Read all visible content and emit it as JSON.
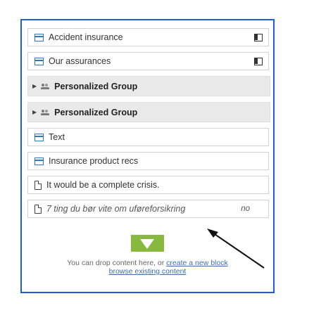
{
  "items": [
    {
      "kind": "block",
      "label": "Accident insurance",
      "action": "folder-icon"
    },
    {
      "kind": "block",
      "label": "Our assurances",
      "action": "folder-icon"
    },
    {
      "kind": "group",
      "label": "Personalized Group"
    },
    {
      "kind": "group",
      "label": "Personalized Group"
    },
    {
      "kind": "block",
      "label": "Text"
    },
    {
      "kind": "block",
      "label": "Insurance product recs"
    },
    {
      "kind": "page",
      "label": "It would be a complete crisis."
    },
    {
      "kind": "page",
      "label": "7 ting du bør vite om uføreforsikring",
      "lang": "no",
      "italic": true
    }
  ],
  "dropzone": {
    "text_before": "You can drop content here, or ",
    "link_create": "create a new block",
    "link_browse": "browse existing content"
  },
  "colors": {
    "frame": "#1f5fd6",
    "drop": "#86b93d",
    "link": "#3a6fb0"
  }
}
